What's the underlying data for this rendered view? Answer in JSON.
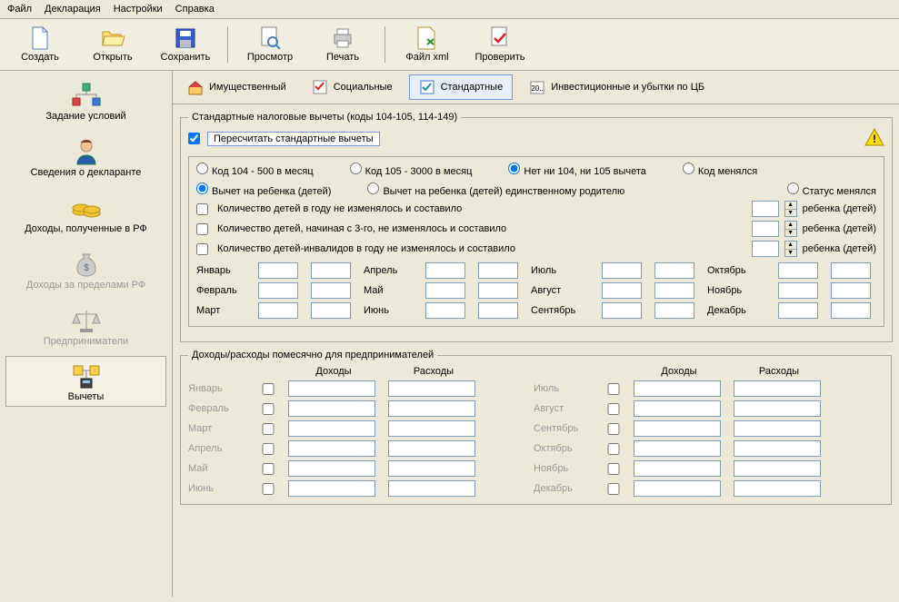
{
  "menu": {
    "items": [
      "Файл",
      "Декларация",
      "Настройки",
      "Справка"
    ]
  },
  "toolbar": {
    "create": "Создать",
    "open": "Открыть",
    "save": "Сохранить",
    "preview": "Просмотр",
    "print": "Печать",
    "filexml": "Файл xml",
    "check": "Проверить"
  },
  "sidebar": {
    "items": [
      {
        "label": "Задание условий"
      },
      {
        "label": "Сведения о декларанте"
      },
      {
        "label": "Доходы, полученные в РФ"
      },
      {
        "label": "Доходы за пределами РФ"
      },
      {
        "label": "Предприниматели"
      },
      {
        "label": "Вычеты"
      }
    ]
  },
  "tabs": {
    "property": "Имущественный",
    "social": "Социальные",
    "standard": "Стандартные",
    "invest": "Инвестиционные и убытки по ЦБ"
  },
  "std": {
    "legend": "Стандартные налоговые вычеты (коды 104-105, 114-149)",
    "recalc": "Пересчитать стандартные вычеты",
    "code104": "Код 104 - 500 в месяц",
    "code105": "Код 105 - 3000 в месяц",
    "codeNone": "Нет ни 104, ни 105 вычета",
    "codeChanged": "Код менялся",
    "childDed": "Вычет на ребенка (детей)",
    "childDedSingle": "Вычет на ребенка (детей) единственному родителю",
    "statusChanged": "Статус менялся",
    "childCount1": "Количество детей в году не изменялось и составило",
    "childCount2": "Количество детей, начиная с 3-го, не изменялось и составило",
    "childCount3": "Количество детей-инвалидов в году не изменялось и составило",
    "childSuffix": "ребенка (детей)"
  },
  "months": [
    "Январь",
    "Февраль",
    "Март",
    "Апрель",
    "Май",
    "Июнь",
    "Июль",
    "Август",
    "Сентябрь",
    "Октябрь",
    "Ноябрь",
    "Декабрь"
  ],
  "entrep": {
    "title": "Доходы/расходы помесячно для предпринимателей",
    "income": "Доходы",
    "expense": "Расходы"
  }
}
